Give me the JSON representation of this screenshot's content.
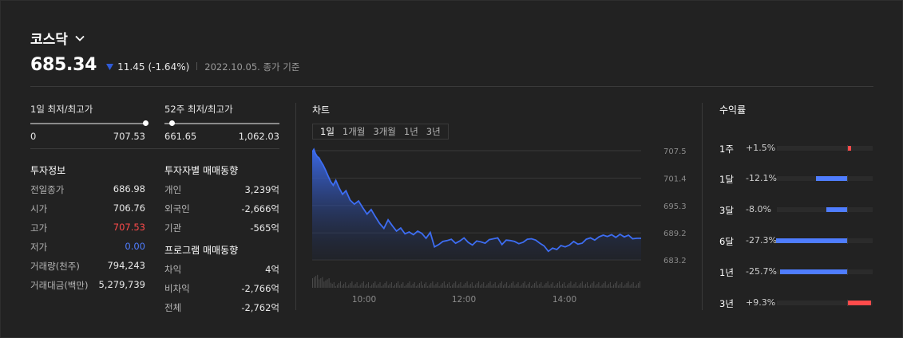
{
  "index": {
    "name": "코스닥",
    "price": "685.34",
    "change": "11.45",
    "change_pct": "(-1.64%)",
    "direction": "down",
    "date": "2022.10.05. 종가 기준"
  },
  "ranges": [
    {
      "label": "1일 최저/최고가",
      "low": "0",
      "high": "707.53",
      "position": 1.0
    },
    {
      "label": "52주 최저/최고가",
      "low": "661.65",
      "high": "1,062.03",
      "position": 0.06
    }
  ],
  "info": {
    "title": "투자정보",
    "rows": [
      {
        "k": "전일종가",
        "v": "686.98",
        "tone": ""
      },
      {
        "k": "시가",
        "v": "706.76",
        "tone": ""
      },
      {
        "k": "고가",
        "v": "707.53",
        "tone": "red"
      },
      {
        "k": "저가",
        "v": "0.00",
        "tone": "blue"
      },
      {
        "k": "거래량(천주)",
        "v": "794,243",
        "tone": ""
      },
      {
        "k": "거래대금(백만)",
        "v": "5,279,739",
        "tone": ""
      }
    ]
  },
  "investor": {
    "title": "투자자별 매매동향",
    "rows": [
      {
        "k": "개인",
        "v": "3,239억"
      },
      {
        "k": "외국인",
        "v": "-2,666억"
      },
      {
        "k": "기관",
        "v": "-565억"
      }
    ]
  },
  "program": {
    "title": "프로그램 매매동향",
    "rows": [
      {
        "k": "차익",
        "v": "4억"
      },
      {
        "k": "비차익",
        "v": "-2,766억"
      },
      {
        "k": "전체",
        "v": "-2,762억"
      }
    ]
  },
  "chart": {
    "title": "차트",
    "tabs": [
      "1일",
      "1개월",
      "3개월",
      "1년",
      "3년"
    ],
    "active_tab": "1일"
  },
  "chart_data": {
    "type": "area",
    "x_labels": [
      "10:00",
      "12:00",
      "14:00"
    ],
    "y_ticks": [
      "707.5",
      "701.4",
      "695.3",
      "689.2",
      "683.2"
    ],
    "ylim": [
      683.2,
      707.5
    ],
    "x": [
      0,
      2,
      4,
      6,
      8,
      10,
      13,
      16,
      19,
      22,
      25,
      28,
      32,
      36,
      40,
      45,
      50,
      55,
      60,
      65,
      70,
      75,
      80,
      85,
      90,
      95,
      100,
      105,
      110,
      115,
      120,
      125,
      130,
      135,
      140,
      145,
      150,
      155,
      160,
      165,
      170,
      175,
      180,
      185,
      190,
      195,
      200,
      205,
      210,
      215,
      220,
      225,
      230,
      235,
      240,
      245,
      250,
      255,
      260,
      265,
      270,
      275,
      280,
      285,
      290,
      295,
      300,
      305,
      310,
      315,
      320,
      325,
      330,
      335,
      340,
      345,
      350,
      355,
      360,
      365,
      370,
      375,
      380,
      385,
      390
    ],
    "y": [
      707.2,
      707.8,
      706.8,
      706.2,
      705.9,
      705.2,
      704.3,
      703.1,
      701.8,
      700.6,
      699.8,
      700.9,
      699.2,
      697.8,
      698.6,
      696.5,
      695.6,
      696.3,
      694.8,
      693.4,
      694.4,
      692.8,
      691.3,
      690.2,
      692.1,
      690.8,
      689.6,
      690.3,
      689.0,
      689.4,
      688.8,
      689.6,
      689.1,
      688.0,
      689.3,
      686.1,
      686.6,
      687.3,
      687.5,
      687.8,
      686.9,
      687.4,
      688.1,
      687.1,
      686.5,
      687.4,
      687.2,
      686.9,
      687.7,
      687.9,
      688.1,
      686.6,
      687.6,
      687.5,
      687.3,
      686.8,
      687.1,
      687.8,
      687.9,
      687.6,
      686.9,
      686.3,
      685.1,
      685.8,
      685.5,
      686.4,
      686.1,
      686.5,
      687.3,
      686.7,
      686.9,
      687.8,
      688.1,
      687.6,
      688.3,
      688.7,
      688.4,
      688.8,
      688.2,
      688.9,
      688.3,
      688.7,
      687.9,
      688.0,
      688.0
    ]
  },
  "returns": {
    "title": "수익률",
    "rows": [
      {
        "period": "1주",
        "value": "+1.5%",
        "pct": 1.5
      },
      {
        "period": "1달",
        "value": "-12.1%",
        "pct": -12.1
      },
      {
        "period": "3달",
        "value": "-8.0%",
        "pct": -8.0
      },
      {
        "period": "6달",
        "value": "-27.3%",
        "pct": -27.3
      },
      {
        "period": "1년",
        "value": "-25.7%",
        "pct": -25.7
      },
      {
        "period": "3년",
        "value": "+9.3%",
        "pct": 9.3
      }
    ]
  },
  "colors": {
    "up": "#ff4b4b",
    "down": "#4f7dff",
    "line": "#3d6df2",
    "triangle": "#2f5bd8"
  }
}
